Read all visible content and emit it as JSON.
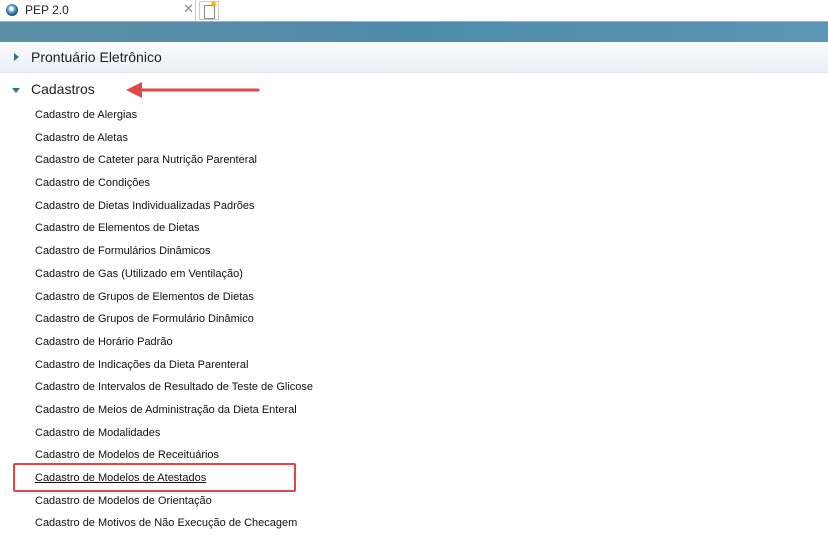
{
  "app": {
    "tab_title": "PEP 2.0",
    "tab_close": "✕"
  },
  "accordion": {
    "sections": [
      {
        "label": "Prontuário Eletrônico",
        "expanded": false
      },
      {
        "label": "Cadastros",
        "expanded": true
      }
    ]
  },
  "menu_items": [
    "Cadastro de Alergias",
    "Cadastro de Aletas",
    "Cadastro de Cateter para Nutrição Parenteral",
    "Cadastro de Condições",
    "Cadastro de Dietas Individualizadas Padrões",
    "Cadastro de Elementos de Dietas",
    "Cadastro de Formulários Dinâmicos",
    "Cadastro de Gas (Utilizado em Ventilação)",
    "Cadastro de Grupos de Elementos de Dietas",
    "Cadastro de Grupos de Formulário Dinâmico",
    "Cadastro de Horário Padrão",
    "Cadastro de Indicações da Dieta Parenteral",
    "Cadastro de Intervalos de Resultado de Teste de Glicose",
    "Cadastro de Meios de Administração da Dieta Enteral",
    "Cadastro de Modalidades",
    "Cadastro de Modelos de Receituários",
    "Cadastro de Modelos de Atestados",
    "Cadastro de Modelos de Orientação",
    "Cadastro de Motivos de Não Execução de Checagem"
  ],
  "active_item": "Cadastro de Modelos de Atestados",
  "colors": {
    "header_bar": "#4e8aa9",
    "caret": "#3b6e93",
    "annotation": "#e04848"
  }
}
